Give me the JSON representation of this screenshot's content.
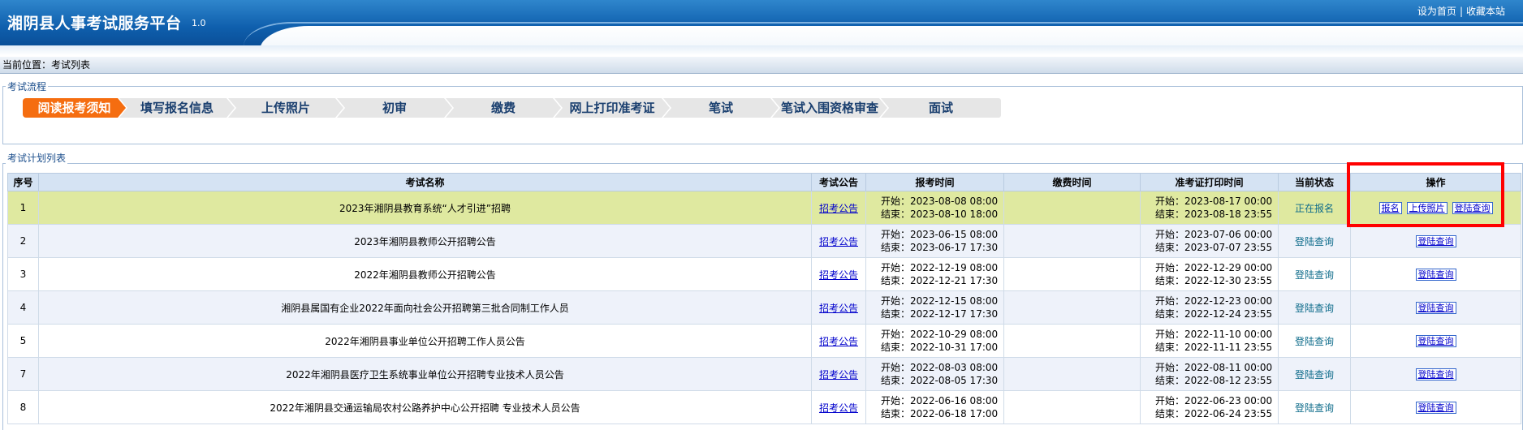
{
  "header": {
    "title": "湘阴县人事考试服务平台",
    "version": "1.0",
    "links": [
      "设为首页",
      "收藏本站"
    ],
    "separator": "|"
  },
  "breadcrumb": "当前位置：考试列表",
  "flow": {
    "legend": "考试流程",
    "steps": [
      "阅读报考须知",
      "填写报名信息",
      "上传照片",
      "初审",
      "缴费",
      "网上打印准考证",
      "笔试",
      "笔试入围资格审查",
      "面试"
    ]
  },
  "list": {
    "legend": "考试计划列表",
    "columns": [
      "序号",
      "考试名称",
      "考试公告",
      "报考时间",
      "缴费时间",
      "准考证打印时间",
      "当前状态",
      "操作"
    ],
    "rows": [
      {
        "no": "1",
        "name": "2023年湘阴县教育系统“人才引进”招聘",
        "notice": "招考公告",
        "reg_start": "开始：2023-08-08 08:00",
        "reg_end": "结束：2023-08-10 18:00",
        "pay": "",
        "print_start": "开始：2023-08-17 00:00",
        "print_end": "结束：2023-08-18 23:55",
        "status": "正在报名",
        "ops": [
          "报名",
          "上传照片",
          "登陆查询"
        ]
      },
      {
        "no": "2",
        "name": "2023年湘阴县教师公开招聘公告",
        "notice": "招考公告",
        "reg_start": "开始：2023-06-15 08:00",
        "reg_end": "结束：2023-06-17 17:30",
        "pay": "",
        "print_start": "开始：2023-07-06 00:00",
        "print_end": "结束：2023-07-07 23:55",
        "status": "登陆查询",
        "ops": [
          "登陆查询"
        ]
      },
      {
        "no": "3",
        "name": "2022年湘阴县教师公开招聘公告",
        "notice": "招考公告",
        "reg_start": "开始：2022-12-19 08:00",
        "reg_end": "结束：2022-12-21 17:30",
        "pay": "",
        "print_start": "开始：2022-12-29 00:00",
        "print_end": "结束：2022-12-30 23:55",
        "status": "登陆查询",
        "ops": [
          "登陆查询"
        ]
      },
      {
        "no": "4",
        "name": "湘阴县属国有企业2022年面向社会公开招聘第三批合同制工作人员",
        "notice": "招考公告",
        "reg_start": "开始：2022-12-15 08:00",
        "reg_end": "结束：2022-12-17 17:30",
        "pay": "",
        "print_start": "开始：2022-12-23 00:00",
        "print_end": "结束：2022-12-24 23:55",
        "status": "登陆查询",
        "ops": [
          "登陆查询"
        ]
      },
      {
        "no": "5",
        "name": "2022年湘阴县事业单位公开招聘工作人员公告",
        "notice": "招考公告",
        "reg_start": "开始：2022-10-29 08:00",
        "reg_end": "结束：2022-10-31 17:00",
        "pay": "",
        "print_start": "开始：2022-11-10 00:00",
        "print_end": "结束：2022-11-11 23:55",
        "status": "登陆查询",
        "ops": [
          "登陆查询"
        ]
      },
      {
        "no": "7",
        "name": "2022年湘阴县医疗卫生系统事业单位公开招聘专业技术人员公告",
        "notice": "招考公告",
        "reg_start": "开始：2022-08-03 08:00",
        "reg_end": "结束：2022-08-05 17:30",
        "pay": "",
        "print_start": "开始：2022-08-11 00:00",
        "print_end": "结束：2022-08-12 23:55",
        "status": "登陆查询",
        "ops": [
          "登陆查询"
        ]
      },
      {
        "no": "8",
        "name": "2022年湘阴县交通运输局农村公路养护中心公开招聘 专业技术人员公告",
        "notice": "招考公告",
        "reg_start": "开始：2022-06-16 08:00",
        "reg_end": "结束：2022-06-18 17:00",
        "pay": "",
        "print_start": "开始：2022-06-23 00:00",
        "print_end": "结束：2022-06-24 23:55",
        "status": "登陆查询",
        "ops": [
          "登陆查询"
        ]
      }
    ]
  },
  "colors": {
    "header_blue": "#0f5fad",
    "active_step": "#f56d10",
    "highlight_row": "#dfe9a0",
    "annotation_red": "#ff0000"
  }
}
